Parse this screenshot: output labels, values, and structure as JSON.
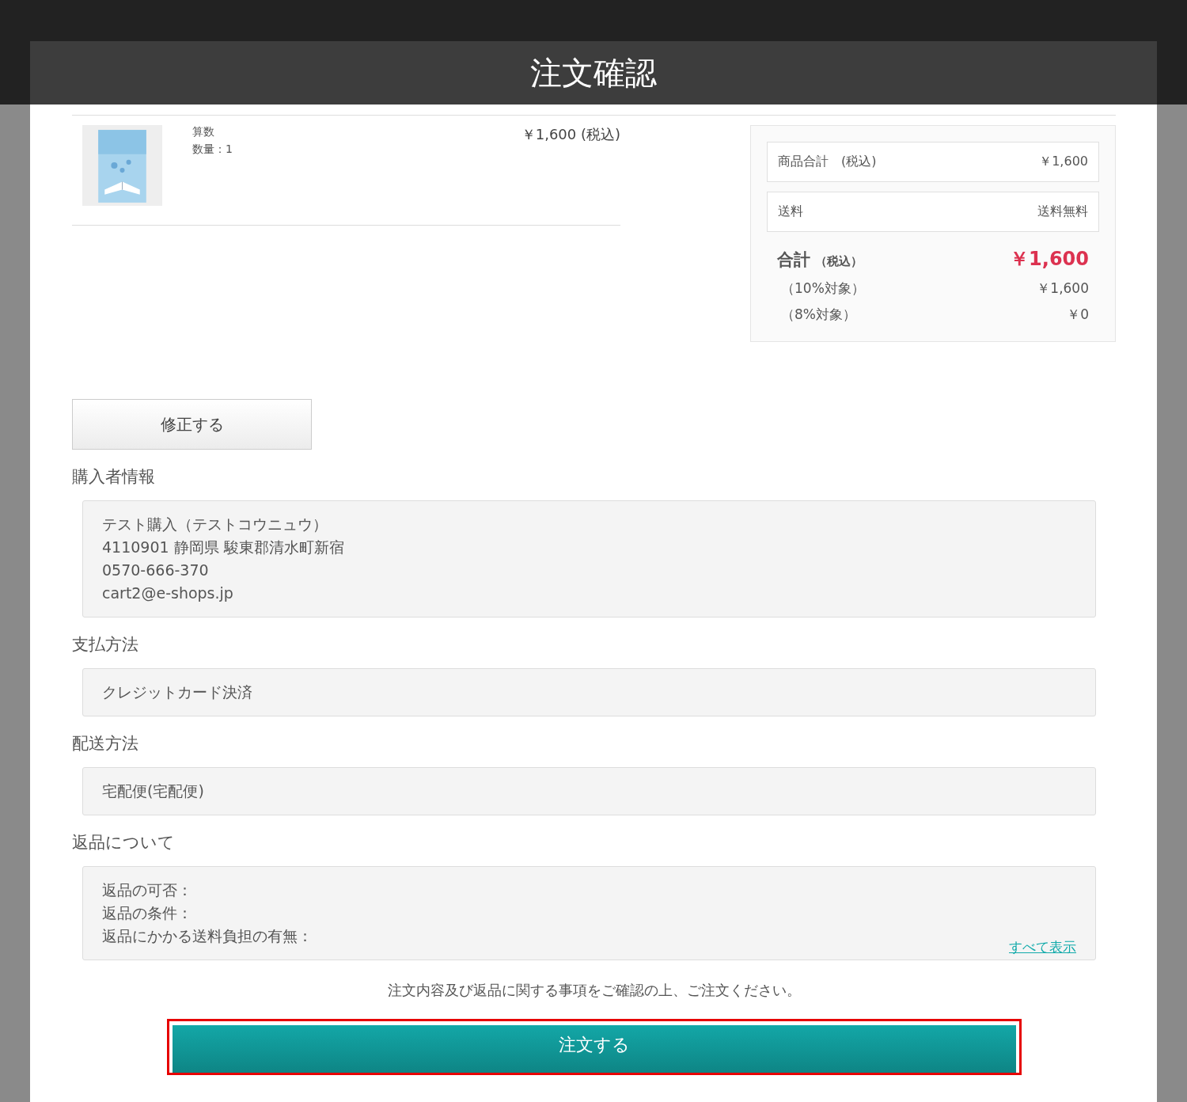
{
  "modal": {
    "title": "注文確認"
  },
  "cart_items": [
    {
      "kind": "picture",
      "name": "算数",
      "quantity": "数量：1",
      "price": "￥1,600 (税込)"
    }
  ],
  "summary": {
    "rows": [
      {
        "label": "商品合計　(税込)",
        "value": "￥1,600"
      },
      {
        "label": "送料",
        "value": "送料無料"
      }
    ],
    "total": {
      "label": "合計",
      "label_note": "（税込）",
      "value": "￥1,600"
    },
    "tax_rows": [
      {
        "label": "（10%対象）",
        "value": "￥1,600"
      },
      {
        "label": "（8%対象）",
        "value": "￥0"
      }
    ]
  },
  "edit_button": "修正する",
  "sections": [
    {
      "title": "購入者情報",
      "lines": [
        "テスト購入（テストコウニュウ）",
        "4110901 静岡県 駿東郡清水町新宿",
        "0570-666-370",
        "cart2@e-shops.jp"
      ]
    },
    {
      "title": "支払方法",
      "lines": [
        "クレジットカード決済"
      ]
    },
    {
      "title": "配送方法",
      "lines": [
        "宅配便(宅配便)"
      ]
    },
    {
      "title": "返品について",
      "lines": [
        "返品の可否：",
        "返品の条件：",
        "返品にかかる送料負担の有無："
      ],
      "link": "すべて表示"
    }
  ],
  "notice": "注文内容及び返品に関する事項をご確認の上、ご注文ください。",
  "order_button": {
    "label": "注文する",
    "highlighted": true
  }
}
